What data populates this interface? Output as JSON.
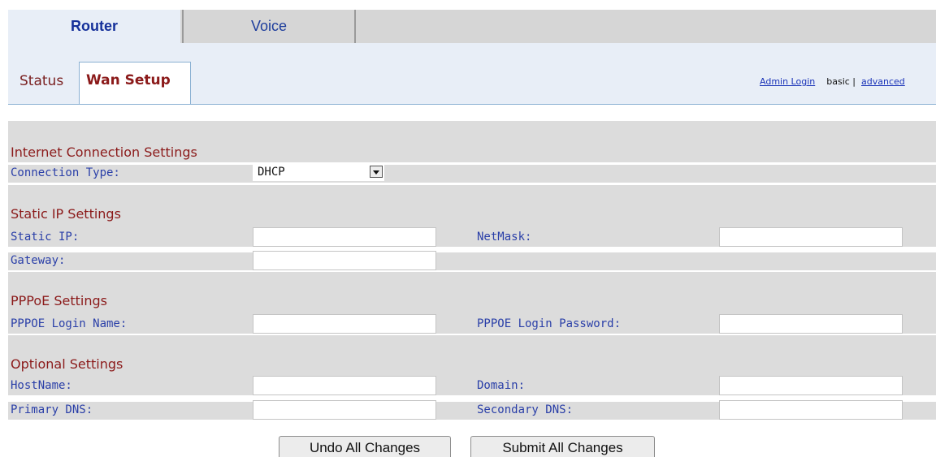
{
  "top_tabs": {
    "router": "Router",
    "voice": "Voice"
  },
  "subnav": {
    "status": "Status",
    "wan_setup": "Wan Setup",
    "admin_login": "Admin Login",
    "basic": "basic",
    "separator": "|",
    "advanced": "advanced"
  },
  "sections": {
    "internet": {
      "title": "Internet Connection Settings",
      "connection_type_label": "Connection Type:",
      "connection_type_value": "DHCP"
    },
    "static": {
      "title": "Static IP Settings",
      "static_ip_label": "Static IP:",
      "netmask_label": "NetMask:",
      "gateway_label": "Gateway:"
    },
    "pppoe": {
      "title": "PPPoE Settings",
      "login_name_label": "PPPOE Login Name:",
      "login_password_label": "PPPOE Login Password:"
    },
    "optional": {
      "title": "Optional Settings",
      "hostname_label": "HostName:",
      "domain_label": "Domain:",
      "primary_dns_label": "Primary DNS:",
      "secondary_dns_label": "Secondary DNS:"
    }
  },
  "buttons": {
    "undo": "Undo All Changes",
    "submit": "Submit All Changes"
  },
  "colors": {
    "section_title": "#8b1a1a",
    "label": "#2a3fa8",
    "band": "#dcdcdc",
    "tab_active_bg": "#e8eef7"
  }
}
